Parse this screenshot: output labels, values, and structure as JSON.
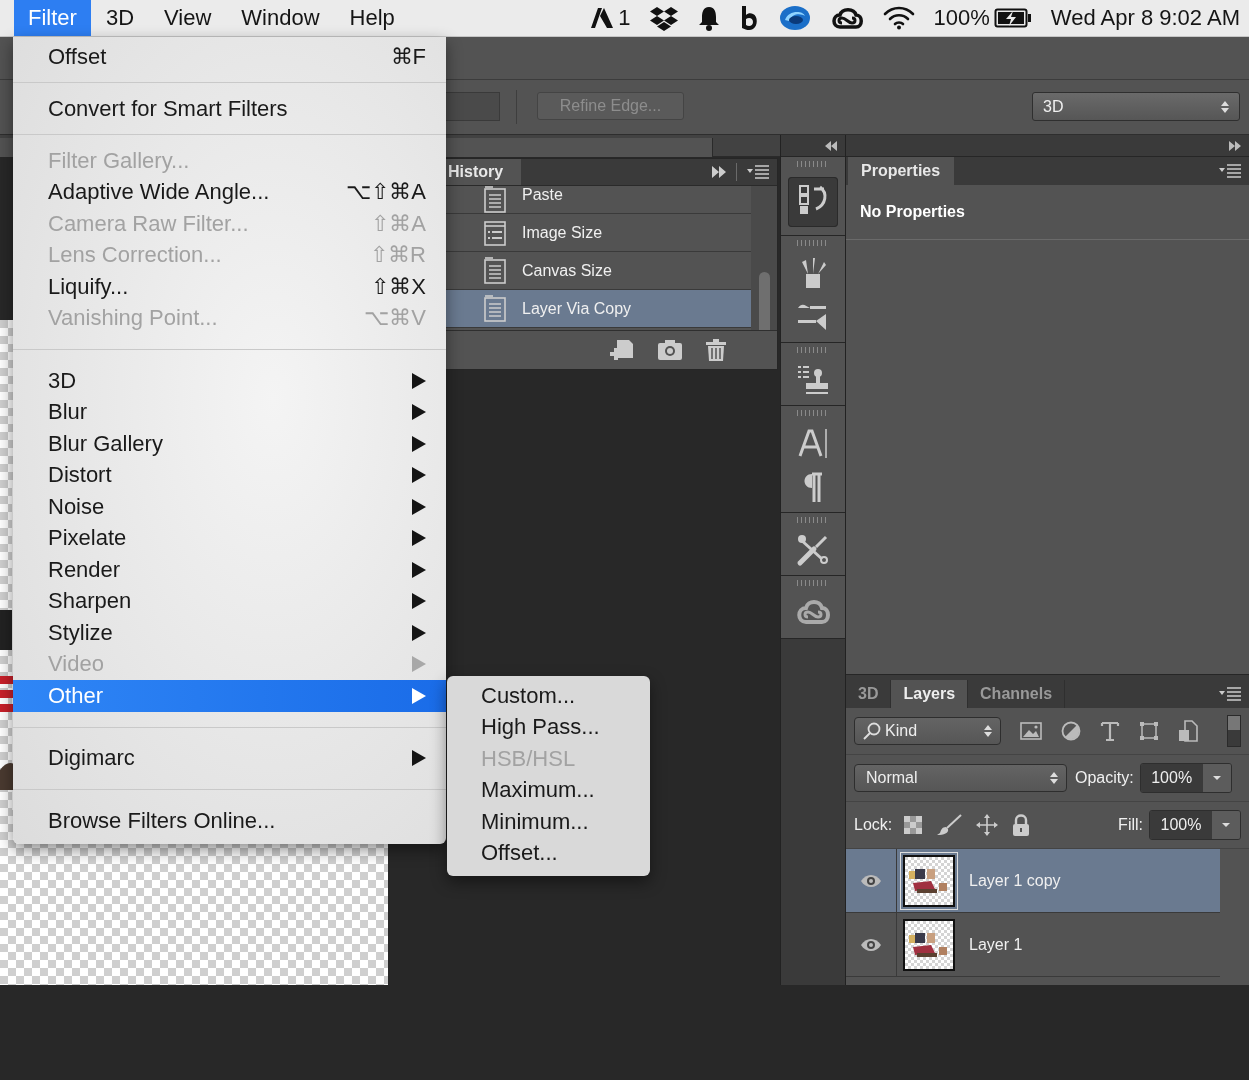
{
  "menubar": {
    "items": [
      {
        "label": "Filter",
        "selected": true
      },
      {
        "label": "3D",
        "selected": false
      },
      {
        "label": "View",
        "selected": false
      },
      {
        "label": "Window",
        "selected": false
      },
      {
        "label": "Help",
        "selected": false
      }
    ],
    "adobe_badge": "1",
    "battery": "100%",
    "clock": "Wed Apr 8 9:02 AM"
  },
  "options_bar": {
    "refine_button": "Refine Edge...",
    "workspace": "3D"
  },
  "history": {
    "title": "History",
    "items": [
      {
        "label": "Paste",
        "kind": "document",
        "selected": false
      },
      {
        "label": "Image Size",
        "kind": "dialog",
        "selected": false
      },
      {
        "label": "Canvas Size",
        "kind": "document",
        "selected": false
      },
      {
        "label": "Layer Via Copy",
        "kind": "document",
        "selected": true
      }
    ]
  },
  "properties": {
    "title": "Properties",
    "message": "No Properties"
  },
  "layers_panel": {
    "tabs": [
      {
        "label": "3D",
        "selected": false
      },
      {
        "label": "Layers",
        "selected": true
      },
      {
        "label": "Channels",
        "selected": false
      }
    ],
    "filter": "Kind",
    "blend_mode": "Normal",
    "opacity_label": "Opacity:",
    "opacity": "100%",
    "lock_label": "Lock:",
    "fill_label": "Fill:",
    "fill": "100%",
    "layers": [
      {
        "name": "Layer 1 copy",
        "selected": true,
        "visible": true
      },
      {
        "name": "Layer 1",
        "selected": false,
        "visible": true
      }
    ]
  },
  "filter_menu": {
    "items": [
      {
        "kind": "item",
        "label": "Offset",
        "shortcut": "⌘F",
        "disabled": false
      },
      {
        "kind": "separator"
      },
      {
        "kind": "item",
        "label": "Convert for Smart Filters",
        "disabled": false
      },
      {
        "kind": "separator"
      },
      {
        "kind": "item",
        "label": "Filter Gallery...",
        "disabled": true
      },
      {
        "kind": "item",
        "label": "Adaptive Wide Angle...",
        "shortcut": "⌥⇧⌘A",
        "disabled": false
      },
      {
        "kind": "item",
        "label": "Camera Raw Filter...",
        "shortcut": "⇧⌘A",
        "disabled": true
      },
      {
        "kind": "item",
        "label": "Lens Correction...",
        "shortcut": "⇧⌘R",
        "disabled": true
      },
      {
        "kind": "item",
        "label": "Liquify...",
        "shortcut": "⇧⌘X",
        "disabled": false
      },
      {
        "kind": "item",
        "label": "Vanishing Point...",
        "shortcut": "⌥⌘V",
        "disabled": true
      },
      {
        "kind": "separator"
      },
      {
        "kind": "submenu",
        "label": "3D",
        "disabled": false,
        "selected": false
      },
      {
        "kind": "submenu",
        "label": "Blur",
        "disabled": false,
        "selected": false
      },
      {
        "kind": "submenu",
        "label": "Blur Gallery",
        "disabled": false,
        "selected": false
      },
      {
        "kind": "submenu",
        "label": "Distort",
        "disabled": false,
        "selected": false
      },
      {
        "kind": "submenu",
        "label": "Noise",
        "disabled": false,
        "selected": false
      },
      {
        "kind": "submenu",
        "label": "Pixelate",
        "disabled": false,
        "selected": false
      },
      {
        "kind": "submenu",
        "label": "Render",
        "disabled": false,
        "selected": false
      },
      {
        "kind": "submenu",
        "label": "Sharpen",
        "disabled": false,
        "selected": false
      },
      {
        "kind": "submenu",
        "label": "Stylize",
        "disabled": false,
        "selected": false
      },
      {
        "kind": "submenu",
        "label": "Video",
        "disabled": true,
        "selected": false
      },
      {
        "kind": "submenu",
        "label": "Other",
        "disabled": false,
        "selected": true
      },
      {
        "kind": "separator"
      },
      {
        "kind": "submenu",
        "label": "Digimarc",
        "disabled": false,
        "selected": false
      },
      {
        "kind": "separator"
      },
      {
        "kind": "item",
        "label": "Browse Filters Online...",
        "disabled": false
      }
    ]
  },
  "other_submenu": {
    "items": [
      {
        "label": "Custom...",
        "disabled": false
      },
      {
        "label": "High Pass...",
        "disabled": false
      },
      {
        "label": "HSB/HSL",
        "disabled": true
      },
      {
        "label": "Maximum...",
        "disabled": false
      },
      {
        "label": "Minimum...",
        "disabled": false
      },
      {
        "label": "Offset...",
        "disabled": false
      }
    ]
  }
}
